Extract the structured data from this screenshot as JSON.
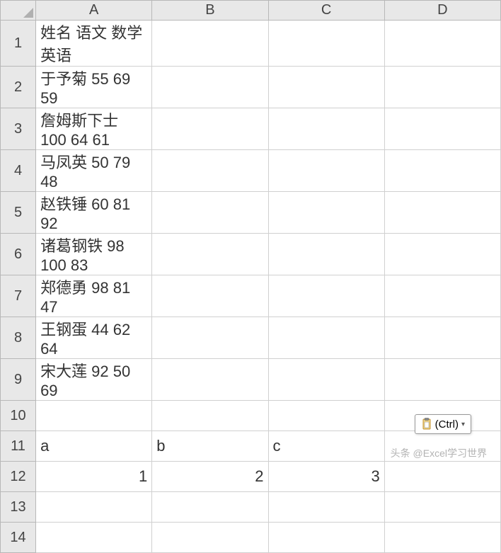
{
  "columns": [
    "A",
    "B",
    "C",
    "D"
  ],
  "rowNumbers": [
    1,
    2,
    3,
    4,
    5,
    6,
    7,
    8,
    9,
    10,
    11,
    12,
    13,
    14
  ],
  "cells": {
    "A1": "姓名 语文 数学 英语",
    "A2": "于予菊 55 69 59",
    "A3": "詹姆斯下士 100 64 61",
    "A4": "马凤英 50 79 48",
    "A5": "赵铁锤 60 81 92",
    "A6": "诸葛钢铁 98 100 83",
    "A7": "郑德勇 98 81 47",
    "A8": "王钢蛋 44 62 64",
    "A9": "宋大莲 92 50 69",
    "A11": "a",
    "B11": "b",
    "C11": "c",
    "A12": "1",
    "B12": "2",
    "C12": "3"
  },
  "pasteButton": {
    "label": "(Ctrl)"
  },
  "watermark": "头条 @Excel学习世界",
  "chart_data": {
    "type": "table",
    "title": "",
    "parsed_table": {
      "headers": [
        "姓名",
        "语文",
        "数学",
        "英语"
      ],
      "rows": [
        {
          "姓名": "于予菊",
          "语文": 55,
          "数学": 69,
          "英语": 59
        },
        {
          "姓名": "詹姆斯下士",
          "语文": 100,
          "数学": 64,
          "英语": 61
        },
        {
          "姓名": "马凤英",
          "语文": 50,
          "数学": 79,
          "英语": 48
        },
        {
          "姓名": "赵铁锤",
          "语文": 60,
          "数学": 81,
          "英语": 92
        },
        {
          "姓名": "诸葛钢铁",
          "语文": 98,
          "数学": 100,
          "英语": 83
        },
        {
          "姓名": "郑德勇",
          "语文": 98,
          "数学": 81,
          "英语": 47
        },
        {
          "姓名": "王钢蛋",
          "语文": 44,
          "数学": 62,
          "英语": 64
        },
        {
          "姓名": "宋大莲",
          "语文": 92,
          "数学": 50,
          "英语": 69
        }
      ]
    }
  }
}
